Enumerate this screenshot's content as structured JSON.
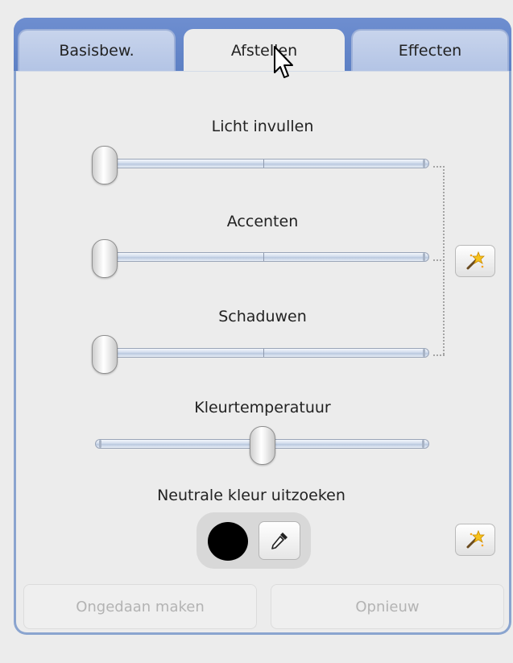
{
  "tabs": [
    {
      "label": "Basisbew.",
      "active": false
    },
    {
      "label": "Afstellen",
      "active": true
    },
    {
      "label": "Effecten",
      "active": false
    }
  ],
  "sliders": {
    "fill_light": {
      "label": "Licht invullen",
      "value": 0.0
    },
    "highlights": {
      "label": "Accenten",
      "value": 0.0
    },
    "shadows": {
      "label": "Schaduwen",
      "value": 0.0
    },
    "color_temperature": {
      "label": "Kleurtemperatuur",
      "value": 0.5
    }
  },
  "neutral_color": {
    "label": "Neutrale kleur uitzoeken",
    "swatch_color": "#000000"
  },
  "icons": {
    "auto_lighting": "magic-wand-icon",
    "auto_color": "magic-wand-icon",
    "eyedropper": "eyedropper-icon",
    "cursor": "mouse-pointer-icon"
  },
  "buttons": {
    "undo": {
      "label": "Ongedaan maken",
      "enabled": false
    },
    "redo": {
      "label": "Opnieuw",
      "enabled": false
    }
  },
  "colors": {
    "tab_bar": "#6e8ed0",
    "inactive_tab": "#c8d4ec",
    "panel_border": "#8aa4cf",
    "disabled_text": "#b3b3b3"
  }
}
